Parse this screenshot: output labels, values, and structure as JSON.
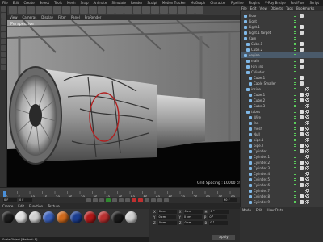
{
  "menubar": [
    "File",
    "Edit",
    "Create",
    "Select",
    "Tools",
    "Mesh",
    "Snap",
    "Animate",
    "Simulate",
    "Render",
    "Sculpt",
    "Motion Tracker",
    "MoGraph",
    "Character",
    "Pipeline",
    "Plugins",
    "V-Ray Bridge",
    "RealFlow",
    "Script",
    "Window",
    "Help"
  ],
  "viewport": {
    "menu": [
      "View",
      "Cameras",
      "Display",
      "Filter",
      "Panel",
      "ProRender"
    ],
    "label": "Perspective",
    "grid_spacing": "Grid Spacing : 10000 cm"
  },
  "timeline": {
    "ticks": [
      "0",
      "5",
      "10",
      "15",
      "20",
      "25",
      "30",
      "35",
      "40",
      "45",
      "50",
      "55",
      "60",
      "65",
      "70",
      "75",
      "80",
      "85",
      "90"
    ],
    "frame": "0 F",
    "end": "90 F"
  },
  "materials": {
    "menu": [
      "Create",
      "Edit",
      "Function",
      "Texture"
    ],
    "swatches": [
      "#1c1c1c",
      "#e0e0e0",
      "#d0d0d0",
      "#3a5fb8",
      "#d06a1c",
      "#1b3d8f",
      "#b01818",
      "#b83030",
      "#1a1a1a",
      "#cfcfcf"
    ]
  },
  "coordinates": {
    "rows": [
      [
        "X",
        "0 cm",
        "X",
        "0 cm",
        "H",
        "0 °"
      ],
      [
        "Y",
        "0 cm",
        "Y",
        "0 cm",
        "P",
        "0 °"
      ],
      [
        "Z",
        "0 cm",
        "Z",
        "0 cm",
        "B",
        "0 °"
      ]
    ],
    "apply": "Apply"
  },
  "status": "Scale Object [Method: E]",
  "objects_menu": [
    "File",
    "Edit",
    "View",
    "Objects",
    "Tags",
    "Bookmarks"
  ],
  "objects": [
    {
      "name": "Floor",
      "indent": 0
    },
    {
      "name": "Light",
      "indent": 0
    },
    {
      "name": "Light.1",
      "indent": 0
    },
    {
      "name": "Light.1 target",
      "indent": 0
    },
    {
      "name": "Cam",
      "indent": 0
    },
    {
      "name": "Cube.1",
      "indent": 1
    },
    {
      "name": "Cube.2",
      "indent": 1
    },
    {
      "name": "engine",
      "indent": 0
    },
    {
      "name": "main",
      "indent": 1
    },
    {
      "name": "Fan .ins",
      "indent": 1
    },
    {
      "name": "Cylinder",
      "indent": 1
    },
    {
      "name": "Cube.1",
      "indent": 2
    },
    {
      "name": "Cable Smaller",
      "indent": 2
    },
    {
      "name": "inside",
      "indent": 1
    },
    {
      "name": "Cube.1",
      "indent": 2
    },
    {
      "name": "Cube.2",
      "indent": 2
    },
    {
      "name": "Cube.3",
      "indent": 2
    },
    {
      "name": "tubes",
      "indent": 1
    },
    {
      "name": "Wire",
      "indent": 2
    },
    {
      "name": "fan",
      "indent": 2
    },
    {
      "name": "mesh",
      "indent": 2
    },
    {
      "name": "Null",
      "indent": 2
    },
    {
      "name": "pipe.1",
      "indent": 2
    },
    {
      "name": "pipe.2",
      "indent": 2
    },
    {
      "name": "Cylinder",
      "indent": 2
    },
    {
      "name": "Cylinder.1",
      "indent": 2
    },
    {
      "name": "Cylinder.2",
      "indent": 2
    },
    {
      "name": "Cylinder.3",
      "indent": 2
    },
    {
      "name": "Cylinder.4",
      "indent": 2
    },
    {
      "name": "Cylinder.5",
      "indent": 2
    },
    {
      "name": "Cylinder.6",
      "indent": 2
    },
    {
      "name": "Cylinder.7",
      "indent": 2
    },
    {
      "name": "Cylinder.8",
      "indent": 2
    },
    {
      "name": "Cylinder.9",
      "indent": 2
    }
  ],
  "attributes": {
    "menu": [
      "Mode",
      "Edit",
      "User Data"
    ]
  }
}
